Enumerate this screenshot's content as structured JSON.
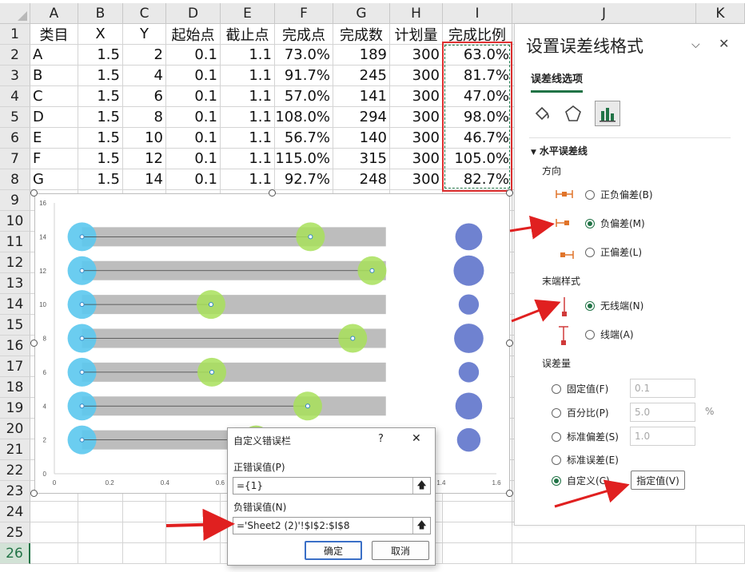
{
  "spreadsheet": {
    "columns": [
      "A",
      "B",
      "C",
      "D",
      "E",
      "F",
      "G",
      "H",
      "I",
      "J",
      "K"
    ],
    "row_numbers": [
      "1",
      "2",
      "3",
      "4",
      "5",
      "6",
      "7",
      "8",
      "9",
      "10",
      "11",
      "12",
      "13",
      "14",
      "15",
      "16",
      "17",
      "18",
      "19",
      "20",
      "21",
      "22",
      "23",
      "24",
      "25",
      "26"
    ],
    "selected_row": "26",
    "header": [
      "类目",
      "X",
      "Y",
      "起始点",
      "截止点",
      "完成点",
      "完成数",
      "计划量",
      "完成比例"
    ],
    "rows": [
      [
        "A",
        "1.5",
        "2",
        "0.1",
        "1.1",
        "73.0%",
        "189",
        "300",
        "63.0%"
      ],
      [
        "B",
        "1.5",
        "4",
        "0.1",
        "1.1",
        "91.7%",
        "245",
        "300",
        "81.7%"
      ],
      [
        "C",
        "1.5",
        "6",
        "0.1",
        "1.1",
        "57.0%",
        "141",
        "300",
        "47.0%"
      ],
      [
        "D",
        "1.5",
        "8",
        "0.1",
        "1.1",
        "108.0%",
        "294",
        "300",
        "98.0%"
      ],
      [
        "E",
        "1.5",
        "10",
        "0.1",
        "1.1",
        "56.7%",
        "140",
        "300",
        "46.7%"
      ],
      [
        "F",
        "1.5",
        "12",
        "0.1",
        "1.1",
        "115.0%",
        "315",
        "300",
        "105.0%"
      ],
      [
        "G",
        "1.5",
        "14",
        "0.1",
        "1.1",
        "92.7%",
        "248",
        "300",
        "82.7%"
      ]
    ],
    "colors": {
      "selection": "#217346",
      "highlight": "#e03030"
    }
  },
  "chart_data": {
    "type": "scatter",
    "title": "",
    "xlabel": "",
    "ylabel": "",
    "xlim": [
      0,
      1.6
    ],
    "ylim": [
      0,
      16
    ],
    "x_ticks": [
      "0",
      "0.2",
      "0.4",
      "0.6",
      "0.8",
      "1",
      "1.2",
      "1.4",
      "1.6"
    ],
    "y_ticks": [
      "0",
      "2",
      "4",
      "6",
      "8",
      "10",
      "12",
      "14",
      "16"
    ],
    "grid": false,
    "series": [
      {
        "role": "start",
        "color": "#5bc8ee",
        "x": [
          0.1,
          0.1,
          0.1,
          0.1,
          0.1,
          0.1,
          0.1
        ],
        "y": [
          2,
          4,
          6,
          8,
          10,
          12,
          14
        ]
      },
      {
        "role": "bar",
        "color": "#bdbdbd",
        "x_from": 0.1,
        "x_to": 1.2,
        "y": [
          2,
          4,
          6,
          8,
          10,
          12,
          14
        ]
      },
      {
        "role": "done",
        "color": "#a8e05a",
        "x": [
          0.73,
          0.917,
          0.57,
          1.08,
          0.567,
          1.15,
          0.927
        ],
        "y": [
          2,
          4,
          6,
          8,
          10,
          12,
          14
        ]
      },
      {
        "role": "bubble",
        "color": "#6f82d0",
        "x": [
          1.5,
          1.5,
          1.5,
          1.5,
          1.5,
          1.5,
          1.5
        ],
        "y": [
          2,
          4,
          6,
          8,
          10,
          12,
          14
        ],
        "size": [
          189,
          245,
          141,
          294,
          140,
          315,
          248
        ]
      }
    ]
  },
  "pane": {
    "title": "设置误差线格式",
    "tab": "误差线选项",
    "section": "水平误差线",
    "direction_label": "方向",
    "direction_options": [
      "正负偏差(B)",
      "负偏差(M)",
      "正偏差(L)"
    ],
    "direction_selected": 1,
    "endstyle_label": "末端样式",
    "endstyle_options": [
      "无线端(N)",
      "线端(A)"
    ],
    "endstyle_selected": 0,
    "amount_label": "误差量",
    "amount_options": [
      "固定值(F)",
      "百分比(P)",
      "标准偏差(S)",
      "标准误差(E)",
      "自定义(C)"
    ],
    "amount_selected": 4,
    "fixed_value": "0.1",
    "percent_value": "5.0",
    "percent_unit": "%",
    "stddev_value": "1.0",
    "specify_button": "指定值(V)",
    "colors": {
      "accent": "#217346",
      "end_marker": "#e0742a",
      "end_marker_red": "#d03a3a"
    }
  },
  "dialog": {
    "title": "自定义错误栏",
    "help": "?",
    "close": "✕",
    "positive_label": "正错误值(P)",
    "positive_value": "={1}",
    "negative_label": "负错误值(N)",
    "negative_value": "='Sheet2 (2)'!$I$2:$I$8",
    "ok": "确定",
    "cancel": "取消"
  }
}
